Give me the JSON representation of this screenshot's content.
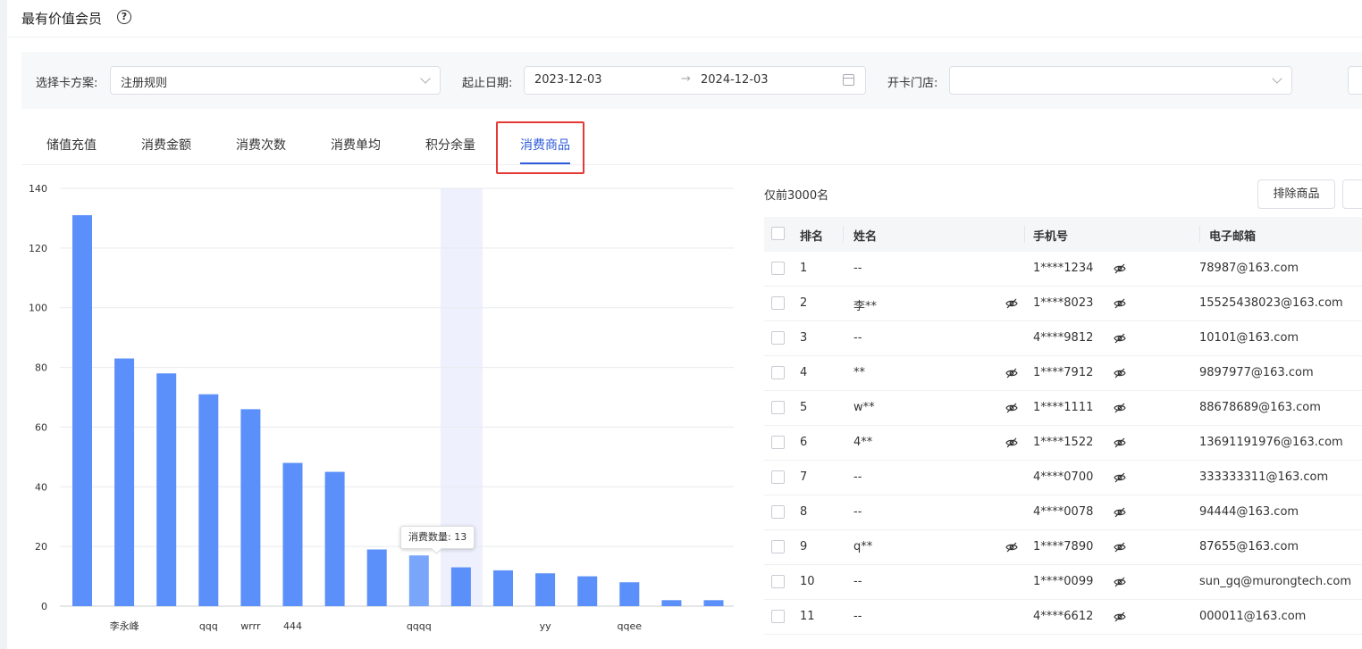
{
  "header": {
    "title": "最有价值会员"
  },
  "filters": {
    "card_label": "选择卡方案:",
    "card_value": "注册规则",
    "date_label": "起止日期:",
    "date_start": "2023-12-03",
    "date_sep": "→",
    "date_end": "2024-12-03",
    "store_label": "开卡门店:",
    "store_value": ""
  },
  "tabs": [
    {
      "label": "储值充值"
    },
    {
      "label": "消费金额"
    },
    {
      "label": "消费次数"
    },
    {
      "label": "消费单均"
    },
    {
      "label": "积分余量"
    },
    {
      "label": "消费商品",
      "active": true
    }
  ],
  "chart_data": {
    "type": "bar",
    "ylim": [
      0,
      140
    ],
    "yticks": [
      0,
      20,
      40,
      60,
      80,
      100,
      120,
      140
    ],
    "categories": [
      "",
      "李永峰",
      "",
      "qqq",
      "wrrr",
      "444",
      "",
      "",
      "qqqq",
      "",
      "",
      "yy",
      "",
      "qqee",
      "",
      ""
    ],
    "values": [
      131,
      83,
      78,
      71,
      66,
      48,
      45,
      19,
      17,
      13,
      12,
      11,
      10,
      8,
      2,
      2
    ],
    "series_color": "#5b8ff9",
    "hover_color": "#79a5fa",
    "hover_band_color": "#eef1fd",
    "hovered_index": 9,
    "tooltip": "消费数量: 13"
  },
  "list": {
    "caption": "仅前3000名",
    "exclude_button": "排除商品",
    "columns": {
      "rank": "排名",
      "name": "姓名",
      "phone": "手机号",
      "email": "电子邮箱"
    },
    "rows": [
      {
        "rank": "1",
        "name": "--",
        "name_eye": false,
        "phone": "1****1234",
        "email": "78987@163.com"
      },
      {
        "rank": "2",
        "name": "李**",
        "name_eye": true,
        "phone": "1****8023",
        "email": "15525438023@163.com"
      },
      {
        "rank": "3",
        "name": "--",
        "name_eye": false,
        "phone": "4****9812",
        "email": "10101@163.com"
      },
      {
        "rank": "4",
        "name": "**",
        "name_eye": true,
        "phone": "1****7912",
        "email": "9897977@163.com"
      },
      {
        "rank": "5",
        "name": "w**",
        "name_eye": true,
        "phone": "1****1111",
        "email": "88678689@163.com"
      },
      {
        "rank": "6",
        "name": "4**",
        "name_eye": true,
        "phone": "1****1522",
        "email": "13691191976@163.com"
      },
      {
        "rank": "7",
        "name": "--",
        "name_eye": false,
        "phone": "4****0700",
        "email": "333333311@163.com"
      },
      {
        "rank": "8",
        "name": "--",
        "name_eye": false,
        "phone": "4****0078",
        "email": "94444@163.com"
      },
      {
        "rank": "9",
        "name": "q**",
        "name_eye": true,
        "phone": "1****7890",
        "email": "87655@163.com"
      },
      {
        "rank": "10",
        "name": "--",
        "name_eye": false,
        "phone": "1****0099",
        "email": "sun_gq@murongtech.com"
      },
      {
        "rank": "11",
        "name": "--",
        "name_eye": false,
        "phone": "4****6612",
        "email": "000011@163.com"
      }
    ]
  }
}
